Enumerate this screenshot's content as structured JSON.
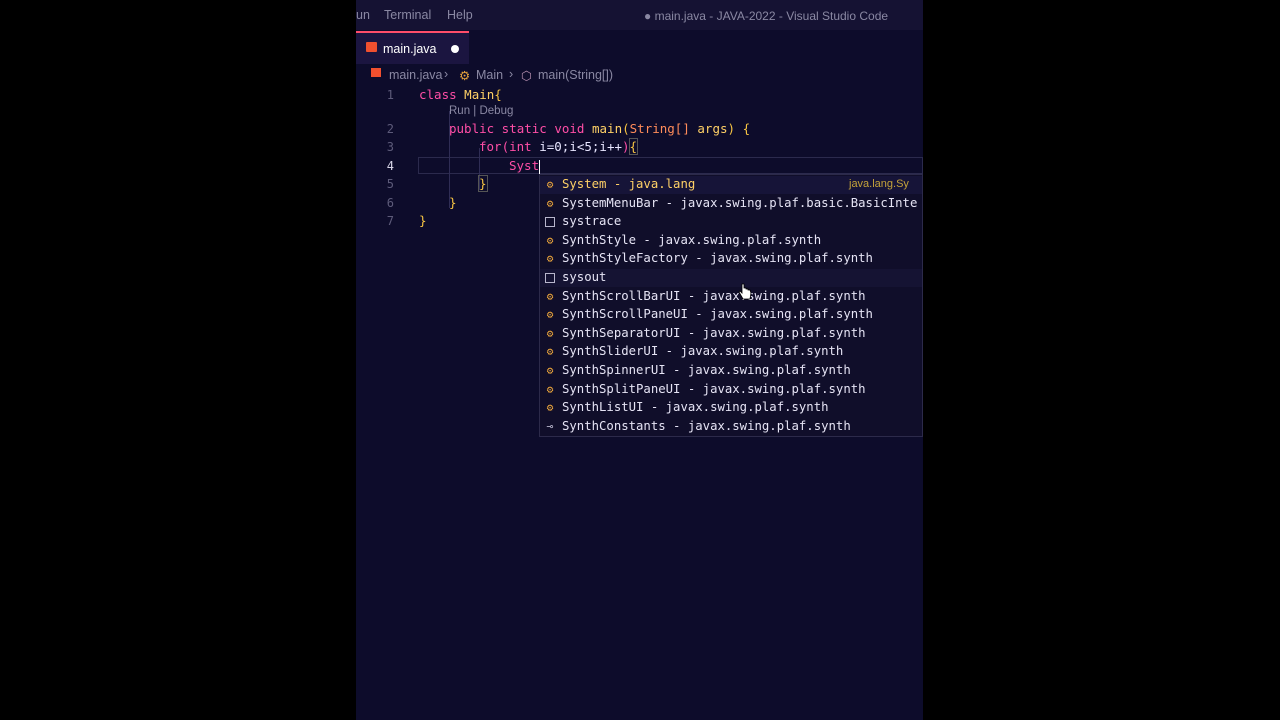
{
  "menubar": {
    "menus": [
      "un",
      "Terminal",
      "Help"
    ],
    "title": "● main.java - JAVA-2022 - Visual Studio Code"
  },
  "tab": {
    "filename": "main.java"
  },
  "breadcrumb": {
    "file": "main.java",
    "class": "Main",
    "method": "main(String[])"
  },
  "editor": {
    "line_numbers": [
      "1",
      "2",
      "3",
      "4",
      "5",
      "6",
      "7"
    ],
    "codelens": "Run | Debug",
    "lines": {
      "l1_kw": "class",
      "l1_name": "Main",
      "l1_brace": "{",
      "l2_mods": "public static void",
      "l2_name": "main",
      "l2_open": "(",
      "l2_type": "String[]",
      "l2_arg": "args",
      "l2_close": ")",
      "l2_brace": "{",
      "l3_for": "for",
      "l3_open": "(",
      "l3_int": "int",
      "l3_rest": "i=0;i<5;i++",
      "l3_close": ")",
      "l3_brace": "{",
      "l4_text": "Syst",
      "l5_brace": "}",
      "l6_brace": "}",
      "l7_brace": "}"
    }
  },
  "suggestions": [
    {
      "icon": "class-icon",
      "label": "System - java.lang",
      "detail": "java.lang.Sy"
    },
    {
      "icon": "class-icon",
      "label": "SystemMenuBar - javax.swing.plaf.basic.BasicInte",
      "detail": ""
    },
    {
      "icon": "snippet-icon",
      "label": "systrace",
      "detail": ""
    },
    {
      "icon": "class-icon",
      "label": "SynthStyle - javax.swing.plaf.synth",
      "detail": ""
    },
    {
      "icon": "class-icon",
      "label": "SynthStyleFactory - javax.swing.plaf.synth",
      "detail": ""
    },
    {
      "icon": "snippet-icon",
      "label": "sysout",
      "detail": ""
    },
    {
      "icon": "class-icon",
      "label": "SynthScrollBarUI - javax.swing.plaf.synth",
      "detail": ""
    },
    {
      "icon": "class-icon",
      "label": "SynthScrollPaneUI - javax.swing.plaf.synth",
      "detail": ""
    },
    {
      "icon": "class-icon",
      "label": "SynthSeparatorUI - javax.swing.plaf.synth",
      "detail": ""
    },
    {
      "icon": "class-icon",
      "label": "SynthSliderUI - javax.swing.plaf.synth",
      "detail": ""
    },
    {
      "icon": "class-icon",
      "label": "SynthSpinnerUI - javax.swing.plaf.synth",
      "detail": ""
    },
    {
      "icon": "class-icon",
      "label": "SynthSplitPaneUI - javax.swing.plaf.synth",
      "detail": ""
    },
    {
      "icon": "class-icon",
      "label": "SynthListUI - javax.swing.plaf.synth",
      "detail": ""
    },
    {
      "icon": "interface-icon",
      "label": "SynthConstants - javax.swing.plaf.synth",
      "detail": ""
    }
  ],
  "colors": {
    "accent": "#ff4d6a",
    "keyword": "#ff4ea6",
    "identifier": "#ffd166",
    "type": "#ff8c5a",
    "background": "#0d0c2b"
  }
}
